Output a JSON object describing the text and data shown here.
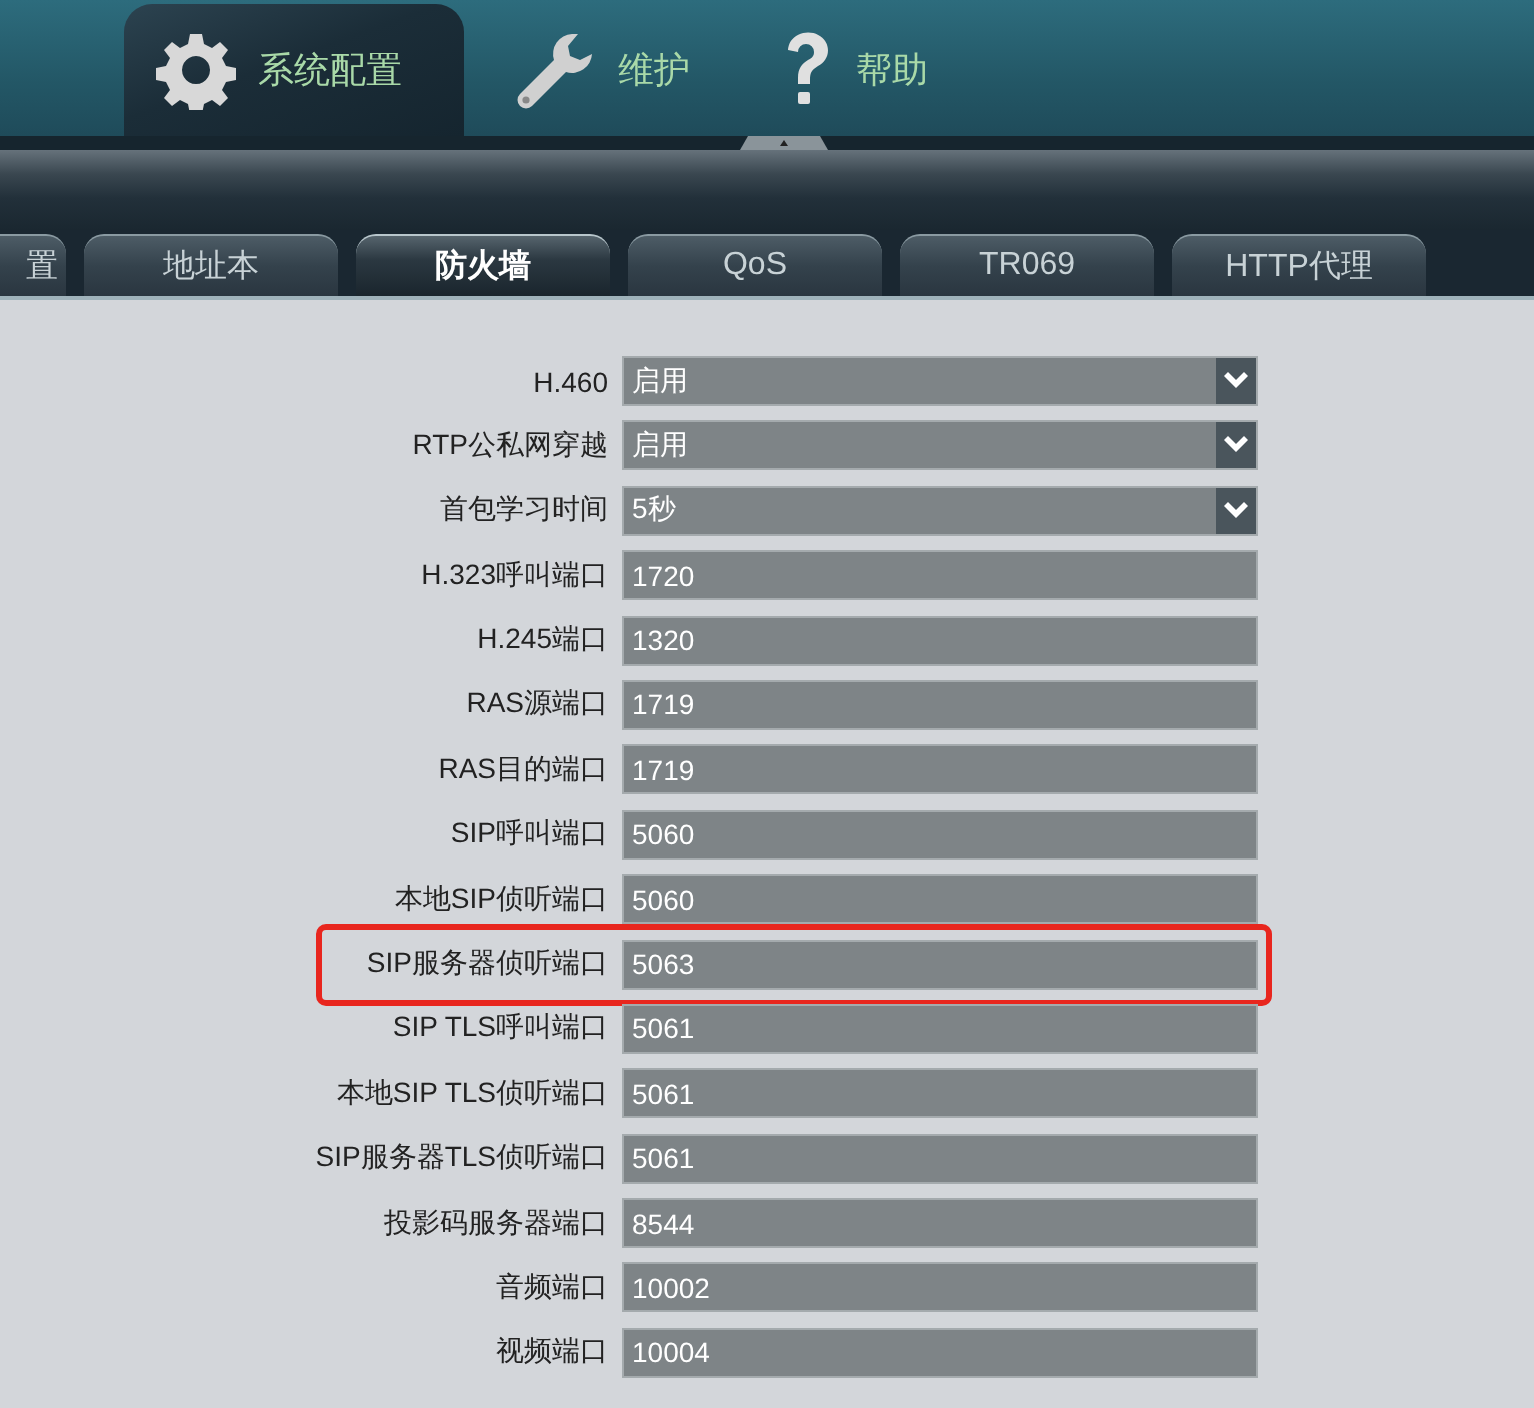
{
  "main_tabs": [
    {
      "label": "系统配置",
      "selected": true
    },
    {
      "label": "维护",
      "selected": false
    },
    {
      "label": "帮助",
      "selected": false
    }
  ],
  "sub_tabs": [
    {
      "label": "置",
      "selected": false
    },
    {
      "label": "地址本",
      "selected": false
    },
    {
      "label": "防火墙",
      "selected": true
    },
    {
      "label": "QoS",
      "selected": false
    },
    {
      "label": "TR069",
      "selected": false
    },
    {
      "label": "HTTP代理",
      "selected": false
    }
  ],
  "fields": [
    {
      "label": "H.460",
      "kind": "select",
      "value": "启用",
      "highlighted": false
    },
    {
      "label": "RTP公私网穿越",
      "kind": "select",
      "value": "启用",
      "highlighted": false
    },
    {
      "label": "首包学习时间",
      "kind": "select",
      "value": "5秒",
      "highlighted": false
    },
    {
      "label": "H.323呼叫端口",
      "kind": "text",
      "value": "1720",
      "highlighted": false
    },
    {
      "label": "H.245端口",
      "kind": "text",
      "value": "1320",
      "highlighted": false
    },
    {
      "label": "RAS源端口",
      "kind": "text",
      "value": "1719",
      "highlighted": false
    },
    {
      "label": "RAS目的端口",
      "kind": "text",
      "value": "1719",
      "highlighted": false
    },
    {
      "label": "SIP呼叫端口",
      "kind": "text",
      "value": "5060",
      "highlighted": false
    },
    {
      "label": "本地SIP侦听端口",
      "kind": "text",
      "value": "5060",
      "highlighted": false
    },
    {
      "label": "SIP服务器侦听端口",
      "kind": "text",
      "value": "5063",
      "highlighted": true
    },
    {
      "label": "SIP TLS呼叫端口",
      "kind": "text",
      "value": "5061",
      "highlighted": false
    },
    {
      "label": "本地SIP TLS侦听端口",
      "kind": "text",
      "value": "5061",
      "highlighted": false
    },
    {
      "label": "SIP服务器TLS侦听端口",
      "kind": "text",
      "value": "5061",
      "highlighted": false
    },
    {
      "label": "投影码服务器端口",
      "kind": "text",
      "value": "8544",
      "highlighted": false
    },
    {
      "label": "音频端口",
      "kind": "text",
      "value": "10002",
      "highlighted": false
    },
    {
      "label": "视频端口",
      "kind": "text",
      "value": "10004",
      "highlighted": false
    }
  ]
}
